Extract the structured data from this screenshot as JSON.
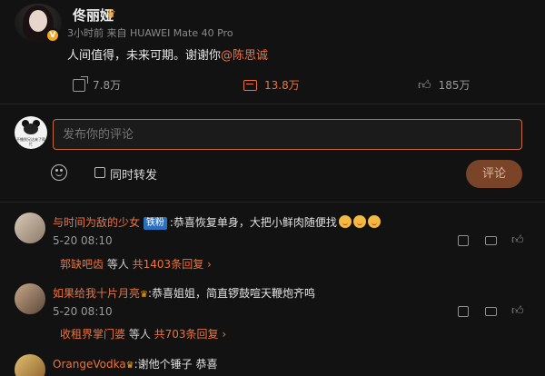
{
  "post": {
    "author": "佟丽娅",
    "meta": "3小时前  来自 HUAWEI Mate 40 Pro",
    "text_prefix": "人间值得，未来可期。谢谢你",
    "mention": "@陈思诚",
    "repost_count": "7.8万",
    "comment_count": "13.8万",
    "like_count": "185万",
    "accent_color": "#eb7340"
  },
  "composer": {
    "placeholder": "发布你的评论",
    "repost_label": "同时转发",
    "submit_label": "评论",
    "avatar_caption": "不撸到兄达来了帮忙"
  },
  "comments": [
    {
      "name": "与时间为敌的少女",
      "badge": "铁粉",
      "text": ":恭喜恢复单身，大把小鲜肉随便找",
      "date": "5-20 08:10",
      "reply_user": "郭缺吧齿",
      "reply_mid": " 等人 ",
      "reply_count": "共1403条回复"
    },
    {
      "name": "如果给我十片月亮",
      "text": ":恭喜姐姐，简直锣鼓喧天鞭炮齐鸣",
      "date": "5-20 08:10",
      "reply_user": "收租界掌门婆",
      "reply_mid": " 等人 ",
      "reply_count": "共703条回复"
    },
    {
      "name": "OrangeVodka",
      "text": ":谢他个锤子 恭喜"
    }
  ]
}
